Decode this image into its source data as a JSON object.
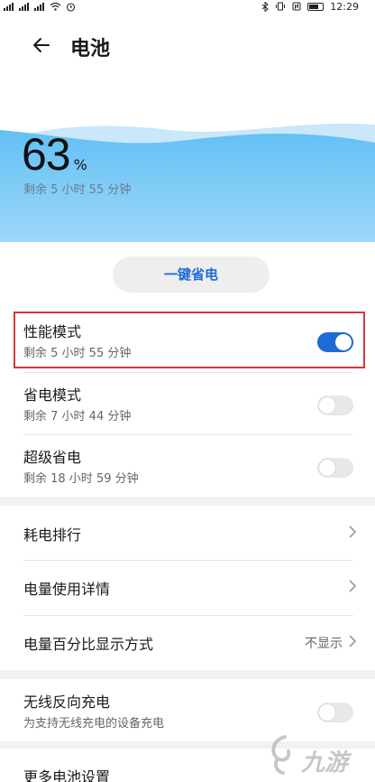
{
  "status_bar": {
    "left_icons": [
      "signal-icon",
      "signal-icon",
      "signal-icon",
      "wifi-icon",
      "alarm-icon"
    ],
    "right_icons": [
      "bluetooth-icon",
      "vibrate-icon",
      "nfc-icon",
      "battery-icon"
    ],
    "time": "12:29"
  },
  "header": {
    "title": "电池"
  },
  "battery": {
    "percent": "63",
    "percent_sign": "%",
    "remaining": "剩余 5 小时 55 分钟",
    "level_fraction": 0.63
  },
  "save_button": {
    "label": "一键省电"
  },
  "modes": [
    {
      "title": "性能模式",
      "subtitle": "剩余 5 小时 55 分钟",
      "enabled": true
    },
    {
      "title": "省电模式",
      "subtitle": "剩余 7 小时 44 分钟",
      "enabled": false
    },
    {
      "title": "超级省电",
      "subtitle": "剩余 18 小时 59 分钟",
      "enabled": false
    }
  ],
  "nav": [
    {
      "label": "耗电排行",
      "value": ""
    },
    {
      "label": "电量使用详情",
      "value": ""
    },
    {
      "label": "电量百分比显示方式",
      "value": "不显示"
    }
  ],
  "wireless": {
    "title": "无线反向充电",
    "subtitle": "为支持无线充电的设备充电",
    "enabled": false
  },
  "more": {
    "label": "更多电池设置"
  },
  "watermark": {
    "text": "九游"
  },
  "colors": {
    "accent": "#1f6bd6",
    "wave_light": "#cbe7fa",
    "wave_main": "#62c0f5",
    "highlight": "#d9363e"
  }
}
